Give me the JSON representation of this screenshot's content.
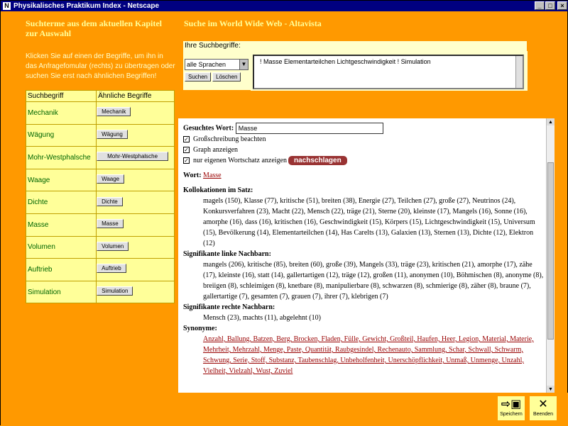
{
  "window": {
    "title": "Physikalisches Praktikum Index - Netscape"
  },
  "left": {
    "heading": "Suchterme aus dem aktuellen Kapitel zur Auswahl",
    "intro": "Klicken Sie auf einen der Begriffe, um ihn in das Anfragefomular (rechts) zu übertragen oder suchen Sie erst nach ähnlichen Begriffen!",
    "col1": "Suchbegriff",
    "col2": "Ähnliche Begriffe",
    "terms": [
      {
        "term": "Mechanik",
        "button": "Mechanik"
      },
      {
        "term": "Wägung",
        "button": "Wägung"
      },
      {
        "term": "Mohr-Westphalsche",
        "button": "Mohr-Westphalsche"
      },
      {
        "term": "Waage",
        "button": "Waage"
      },
      {
        "term": "Dichte",
        "button": "Dichte"
      },
      {
        "term": "Masse",
        "button": "Masse"
      },
      {
        "term": "Volumen",
        "button": "Volumen"
      },
      {
        "term": "Auftrieb",
        "button": "Auftrieb"
      },
      {
        "term": "Simulation",
        "button": "Simulation"
      }
    ]
  },
  "right": {
    "heading": "Suche im World Wide Web - Altavista",
    "panel_label": "Ihre Suchbegriffe:",
    "lang_select": "alle Sprachen",
    "btn_search": "Suchen",
    "btn_clear": "Löschen",
    "query": "! Masse Elementarteilchen Lichtgeschwindigkeit ! Simulation"
  },
  "result": {
    "sought_label": "Gesuchtes Wort:",
    "sought_value": "Masse",
    "cb1": "Großschreibung beachten",
    "cb2": "Graph anzeigen",
    "cb3": "nur eigenen Wortschatz anzeigen",
    "lookup_btn": "nachschlagen",
    "word_label": "Wort:",
    "word": "Masse",
    "koll_label": "Kollokationen im Satz:",
    "koll": "magels (150), Klasse (77), kritische (51), breiten (38), Energie (27), Teilchen (27), große (27), Neutrinos (24), Konkursverfahren (23), Macht (22), Mensch (22), träge (21), Sterne (20), kleinste (17), Mangels (16), Sonne (16), amorphe (16), dass (16), kritischen (16), Geschwindigkeit (15), Körpers (15), Lichtgeschwindigkeit (15), Universum (15), Bevölkerung (14), Elementarteilchen (14), Has Carelts (13), Galaxien (13), Sternen (13), Dichte (12), Elektron (12)",
    "links_label": "Signifikante linke Nachbarn:",
    "links": "mangels (206), kritische (85), breiten (60), große (39), Mangels (33), träge (23), kritischen (21), amorphe (17), zähe (17), kleinste (16), statt (14), gallertartigen (12), träge (12), großen (11), anonymen (10), Böhmischen (8), anonyme (8), breiigen (8), schleimigen (8), knetbare (8), manipulierbare (8), schwarzen (8), schmierige (8), zäher (8), braune (7), gallertartige (7), gesamten (7), grauen (7), ihrer (7), klebrigen (7)",
    "rechts_label": "Signifikante rechte Nachbarn:",
    "rechts": "Mensch (23), machts (11), abgelehnt (10)",
    "syn_label": "Synonyme:",
    "syn": "Anzahl, Ballung, Batzen, Berg, Brocken, Fladen, Fülle, Gewicht, Großteil, Haufen, Heer, Legion, Material, Materie, Mehrheit, Mehrzahl, Menge, Paste, Quantität, Raubgesindel, Rechenauto, Sammlung, Schar, Schwall, Schwarm, Schwung, Serie, Stoff, Substanz, Taubenschlag, Unbeholfenheit, Unerschöpflichkeit, Unmaß, Unmenge, Unzahl, Vielheit, Vielzahl, Wust, Zuviel"
  },
  "bottom": {
    "save_label": "Speichern",
    "quit_label": "Beenden"
  }
}
